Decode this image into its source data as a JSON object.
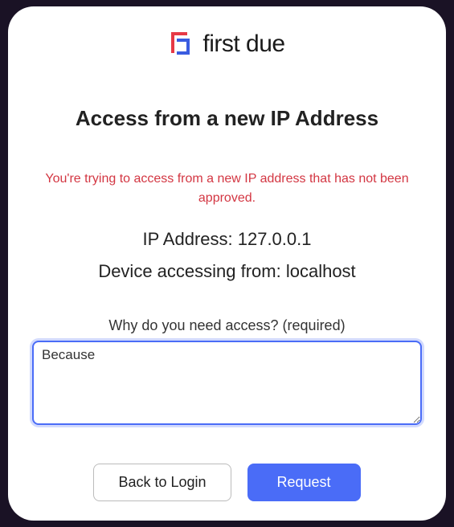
{
  "brand": {
    "name": "first due"
  },
  "heading": "Access from a new IP Address",
  "warning": "You're trying to access from a new IP address that has not been approved.",
  "ip": {
    "label": "IP Address: ",
    "value": "127.0.0.1"
  },
  "device": {
    "label": "Device accessing from: ",
    "value": "localhost"
  },
  "reason": {
    "label": "Why do you need access? (required)",
    "value": "Because"
  },
  "buttons": {
    "back": "Back to Login",
    "request": "Request"
  }
}
